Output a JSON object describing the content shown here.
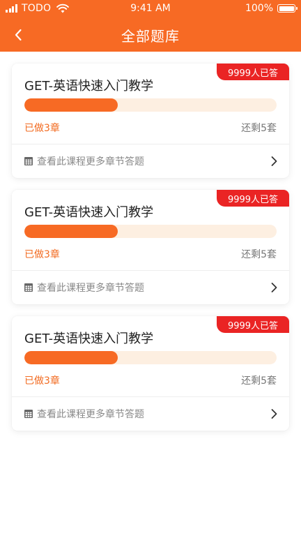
{
  "status_bar": {
    "carrier": "TODO",
    "time": "9:41 AM",
    "battery": "100%"
  },
  "nav": {
    "title": "全部题库"
  },
  "colors": {
    "brand": "#f76a24",
    "badge": "#ea2424",
    "track": "#fdefe1"
  },
  "cards": [
    {
      "badge": "9999人已答",
      "title": "GET-英语快速入门教学",
      "progress": 0.37,
      "done": "已做3章",
      "remaining": "还剩5套",
      "more": "查看此课程更多章节答题"
    },
    {
      "badge": "9999人已答",
      "title": "GET-英语快速入门教学",
      "progress": 0.37,
      "done": "已做3章",
      "remaining": "还剩5套",
      "more": "查看此课程更多章节答题"
    },
    {
      "badge": "9999人已答",
      "title": "GET-英语快速入门教学",
      "progress": 0.37,
      "done": "已做3章",
      "remaining": "还剩5套",
      "more": "查看此课程更多章节答题"
    }
  ]
}
